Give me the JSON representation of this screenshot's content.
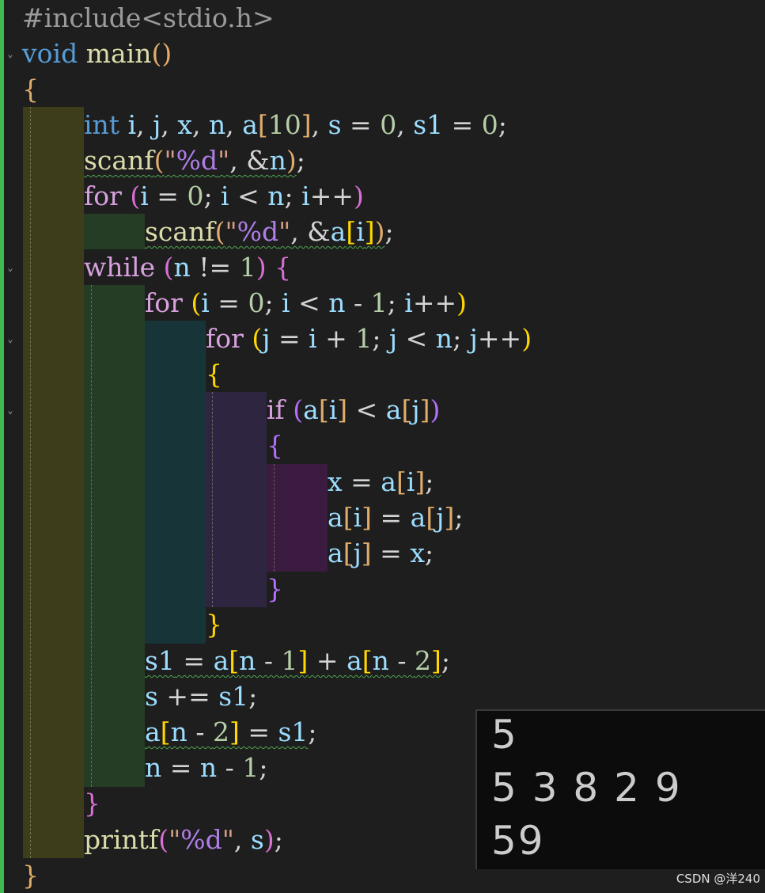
{
  "editor": {
    "lines": [
      {
        "text": "#include<stdio.h>"
      },
      {
        "text": "void main()"
      },
      {
        "text": "{"
      },
      {
        "text": "int i, j, x, n, a[10], s = 0, s1 = 0;"
      },
      {
        "text": "scanf(\"%d\", &n);"
      },
      {
        "text": "for (i = 0; i < n; i++)"
      },
      {
        "text": "scanf(\"%d\", &a[i]);"
      },
      {
        "text": "while (n != 1) {"
      },
      {
        "text": "for (i = 0; i < n - 1; i++)"
      },
      {
        "text": "for (j = i + 1; j < n; j++)"
      },
      {
        "text": "{"
      },
      {
        "text": "if (a[i] < a[j])"
      },
      {
        "text": "{"
      },
      {
        "text": "x = a[i];"
      },
      {
        "text": "a[i] = a[j];"
      },
      {
        "text": "a[j] = x;"
      },
      {
        "text": "}"
      },
      {
        "text": "}"
      },
      {
        "text": "s1 = a[n - 1] + a[n - 2];"
      },
      {
        "text": "s += s1;"
      },
      {
        "text": "a[n - 2] = s1;"
      },
      {
        "text": "n = n - 1;"
      },
      {
        "text": "}"
      },
      {
        "text": "printf(\"%d\", s);"
      },
      {
        "text": "}"
      }
    ],
    "fold_icon": "chevron-down-icon",
    "colors": {
      "background": "#1e1e1e",
      "change_bar": "#3fb950",
      "indent_level1": "#3d3d1c",
      "indent_level2": "#243d24",
      "indent_level3": "#173539",
      "indent_level4": "#2e2540",
      "indent_level5": "#3b1b40"
    }
  },
  "console": {
    "lines": [
      "5",
      "5 3 8 2 9",
      "59"
    ]
  },
  "watermark": "CSDN @洋240"
}
